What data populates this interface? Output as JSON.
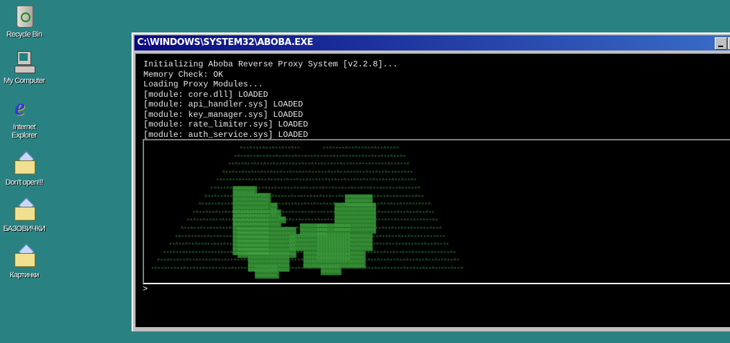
{
  "desktop": {
    "icons": [
      {
        "label": "Recycle Bin",
        "icon": "recycle-bin-icon"
      },
      {
        "label": "My Computer",
        "icon": "computer-icon"
      },
      {
        "label": "Internet Explorer",
        "icon": "internet-explorer-icon"
      },
      {
        "label": "Don't open!!!",
        "icon": "folder-icon"
      },
      {
        "label": "БАЗОВИЧКИ",
        "icon": "folder-icon"
      },
      {
        "label": "Картинки",
        "icon": "folder-icon"
      }
    ]
  },
  "window": {
    "title": "C:\\WINDOWS\\SYSTEM32\\ABOBA.EXE",
    "console_lines": [
      "Initializing Aboba Reverse Proxy System [v2.2.8]...",
      "Memory Check: OK",
      "Loading Proxy Modules...",
      "[module: core.dll] LOADED",
      "[module: api_handler.sys] LOADED",
      "[module: key_manager.sys] LOADED",
      "[module: rate_limiter.sys] LOADED",
      "[module: auth_service.sys] LOADED"
    ],
    "prompt": ">",
    "art_color": "#3a9a3a"
  },
  "colors": {
    "desktop": "#2a8181",
    "title_start": "#0a0a80",
    "title_end": "#3a6ec8"
  }
}
